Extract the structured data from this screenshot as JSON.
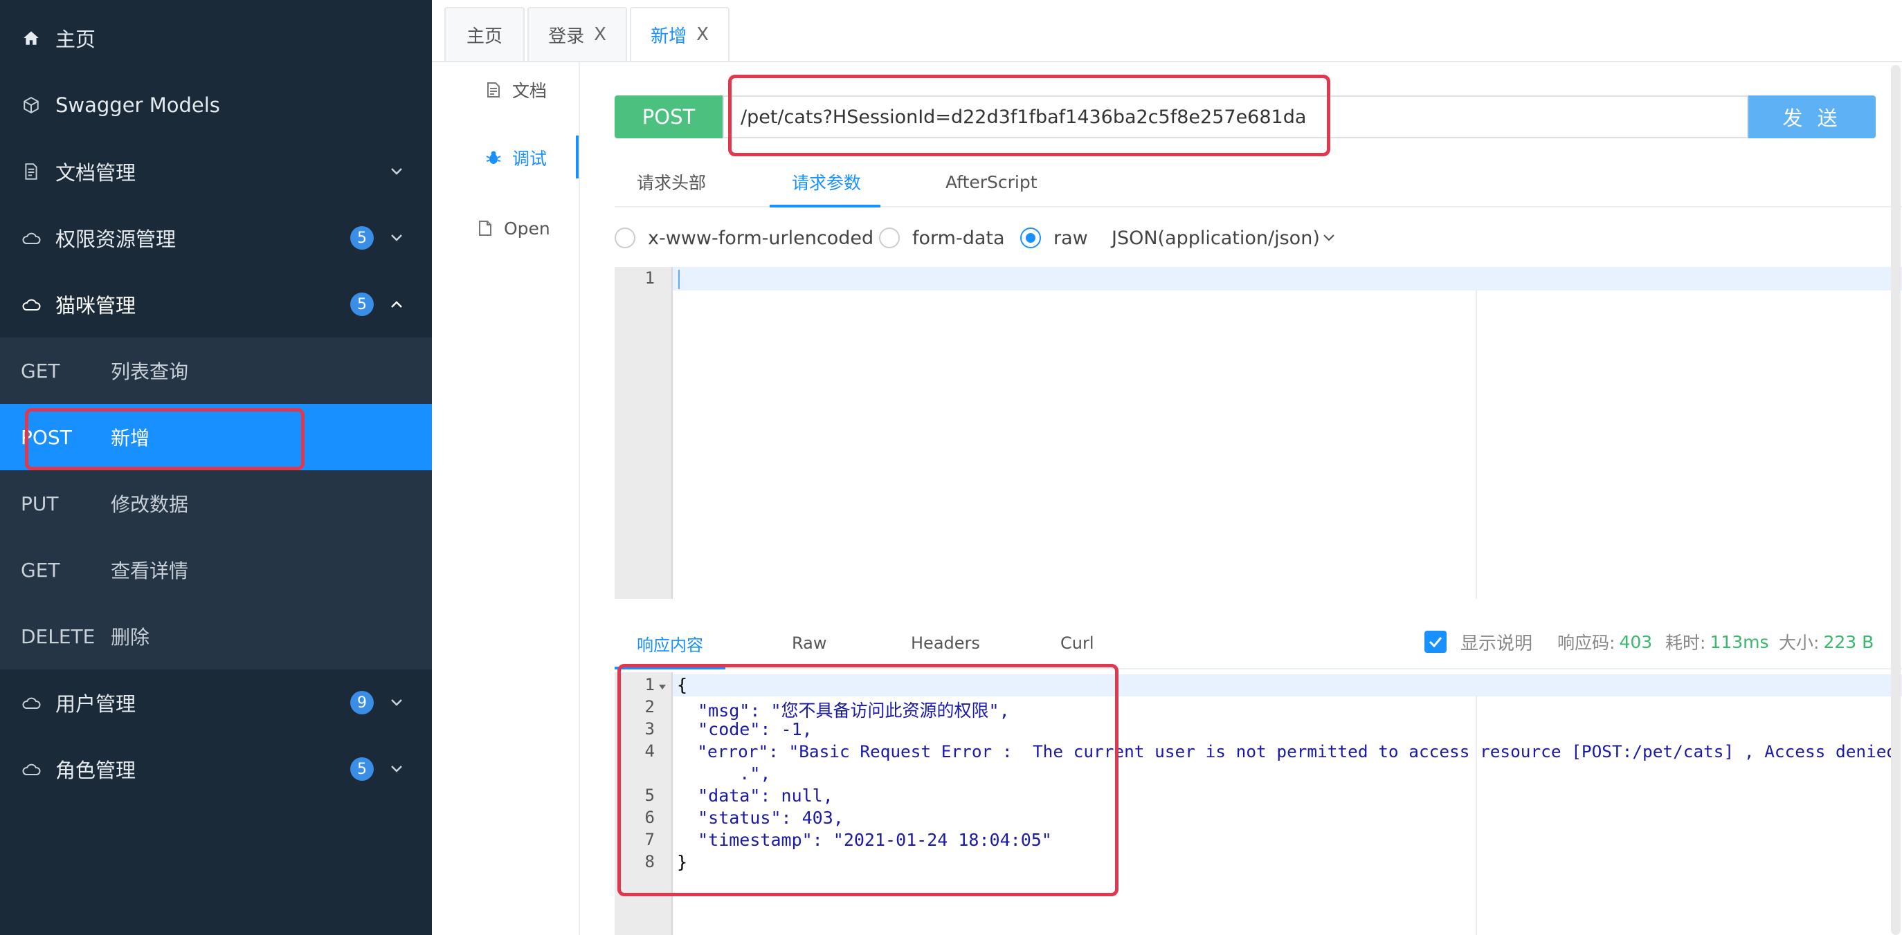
{
  "sidebar": {
    "items": [
      {
        "label": "主页",
        "icon": "home-icon"
      },
      {
        "label": "Swagger Models",
        "icon": "cube-icon"
      },
      {
        "label": "文档管理",
        "icon": "document-icon"
      },
      {
        "label": "权限资源管理",
        "icon": "cloud-icon",
        "badge": "5"
      },
      {
        "label": "猫咪管理",
        "icon": "cloud-icon",
        "badge": "5"
      },
      {
        "label": "用户管理",
        "icon": "cloud-icon",
        "badge": "9"
      },
      {
        "label": "角色管理",
        "icon": "cloud-icon",
        "badge": "5"
      }
    ],
    "apis": [
      {
        "method": "GET",
        "label": "列表查询"
      },
      {
        "method": "POST",
        "label": "新增"
      },
      {
        "method": "PUT",
        "label": "修改数据"
      },
      {
        "method": "GET",
        "label": "查看详情"
      },
      {
        "method": "DELETE",
        "label": "删除"
      }
    ]
  },
  "tabs": [
    {
      "label": "主页"
    },
    {
      "label": "登录",
      "close": "X"
    },
    {
      "label": "新增",
      "close": "X"
    }
  ],
  "inner_nav": [
    {
      "label": "文档",
      "icon": "document-icon"
    },
    {
      "label": "调试",
      "icon": "bug-icon"
    },
    {
      "label": "Open",
      "icon": "file-icon"
    }
  ],
  "request": {
    "method": "POST",
    "url": "/pet/cats?HSessionId=d22d3f1fbaf1436ba2c5f8e257e681da",
    "send_label": "发 送"
  },
  "request_tabs": [
    "请求头部",
    "请求参数",
    "AfterScript"
  ],
  "body_types": {
    "options": [
      "x-www-form-urlencoded",
      "form-data",
      "raw"
    ],
    "selected": "raw",
    "content_type": "JSON(application/json)"
  },
  "request_editor": {
    "line_numbers": [
      "1"
    ]
  },
  "response_tabs": [
    "响应内容",
    "Raw",
    "Headers",
    "Curl"
  ],
  "response_meta": {
    "show_desc_label": "显示说明",
    "code_label": "响应码:",
    "code_value": "403",
    "time_label": "耗时:",
    "time_value": "113ms",
    "size_label": "大小:",
    "size_value": "223 B"
  },
  "response_editor": {
    "line_numbers": [
      "1",
      "2",
      "3",
      "4",
      "",
      "5",
      "6",
      "7",
      "8"
    ],
    "lines": [
      "{",
      "  \"msg\": \"您不具备访问此资源的权限\",",
      "  \"code\": -1,",
      "  \"error\": \"Basic Request Error :  The current user is not permitted to access resource [POST:/pet/cats] , Access denied",
      "      .\",",
      "  \"data\": null,",
      "  \"status\": 403,",
      "  \"timestamp\": \"2021-01-24 18:04:05\"",
      "}"
    ]
  },
  "colors": {
    "sidebar_bg": "#1b2a38",
    "accent": "#1890ff",
    "post": "#4cc17f",
    "highlight": "#e0384f",
    "success_value": "#38b86d"
  }
}
